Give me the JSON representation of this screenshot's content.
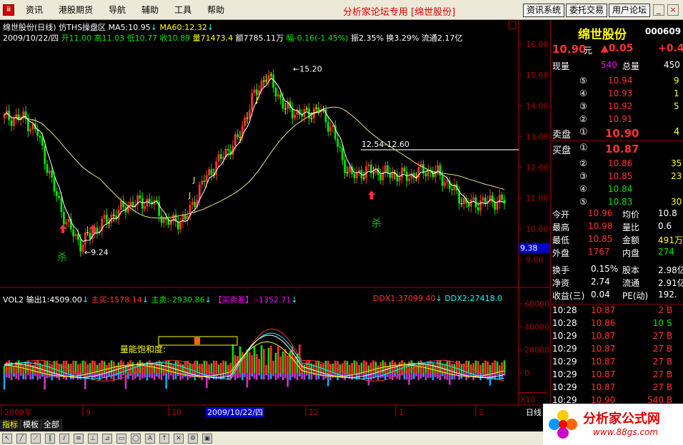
{
  "menu": {
    "items": [
      "资讯",
      "港股期货",
      "导航",
      "辅助",
      "工具",
      "帮助"
    ],
    "title": "分析家论坛专用 [绵世股份]",
    "buttons": [
      "资讯系统",
      "委托交易",
      "用户论坛"
    ],
    "window_controls": [
      "_",
      "▫",
      "×"
    ]
  },
  "info": {
    "line1": {
      "name": "绵世股份(日线)",
      "mode": "仿THS操盘区",
      "ma5": "MA5:10.95",
      "ma60": "MA60:12.32"
    },
    "line2": {
      "date": "2009/10/22/四",
      "open": "开11.00",
      "high": "高11.03",
      "low": "低10.77",
      "close": "收10.89",
      "volume": "量71473.4",
      "amount": "额7785.11万",
      "change": "幅-0.16(-1.45%)",
      "amplitude": "振2.35%",
      "turnover": "换3.29%",
      "float": "流通2.17亿"
    }
  },
  "price_axis": [
    "16.00",
    "15.00",
    "14.00",
    "13.00",
    "12.00",
    "11.00",
    "10.00",
    "9.00"
  ],
  "price_marker": "9.38",
  "annotations": {
    "high": "15.20",
    "low": "9.24",
    "range": "12.54-12.60",
    "kill1": "杀",
    "kill2": "杀",
    "j1": "J",
    "j2": "J",
    "j3": "J"
  },
  "indicator": {
    "name": "VOL2",
    "out1": "输出1:4509.00",
    "buy": "主买:1578.14",
    "sell": "主卖:-2930.86",
    "diff": "【买卖差】:-1352.71",
    "ddx1": "DDX1:37099.40",
    "ddx2": "DDX2:27418.0",
    "saturation_label": "量能饱和度:",
    "axis": [
      "60000",
      "40000",
      "20000",
      "0"
    ],
    "scale": "X10"
  },
  "time_axis": {
    "labels": [
      "2009年",
      "9",
      "10",
      "2009/10/22/四",
      "12",
      "1",
      "2"
    ],
    "period": "日线"
  },
  "quote": {
    "name": "绵世股份",
    "code": "000609",
    "price": "10.90",
    "unit": "元",
    "change": "▲0.05",
    "change_pct": "+0.4",
    "current_vol_label": "现量",
    "current_vol": "540",
    "total_vol_label": "总量",
    "total_vol": "450",
    "sells": [
      {
        "lvl": "⑤",
        "price": "10.94",
        "vol": "9"
      },
      {
        "lvl": "④",
        "price": "10.93",
        "vol": "1"
      },
      {
        "lvl": "③",
        "price": "10.92",
        "vol": "5"
      },
      {
        "lvl": "②",
        "price": "10.91",
        "vol": ""
      }
    ],
    "sell1": {
      "label": "卖盘",
      "lvl": "①",
      "price": "10.90",
      "vol": "4"
    },
    "buy1": {
      "label": "买盘",
      "lvl": "①",
      "price": "10.87",
      "vol": ""
    },
    "buys": [
      {
        "lvl": "②",
        "price": "10.86",
        "vol": "35"
      },
      {
        "lvl": "③",
        "price": "10.85",
        "vol": "23"
      },
      {
        "lvl": "④",
        "price": "10.84",
        "vol": ""
      },
      {
        "lvl": "⑤",
        "price": "10.83",
        "vol": "30"
      }
    ],
    "stats": [
      {
        "l1": "今开",
        "v1": "10.96",
        "l2": "均价",
        "v2": "10.8"
      },
      {
        "l1": "最高",
        "v1": "10.98",
        "l2": "量比",
        "v2": "0.6"
      },
      {
        "l1": "最低",
        "v1": "10.85",
        "l2": "金额",
        "v2": "491万"
      },
      {
        "l1": "外盘",
        "v1": "1767",
        "l2": "内盘",
        "v2": "274"
      }
    ],
    "stats2": [
      {
        "l1": "换手",
        "v1": "0.15%",
        "l2": "股本",
        "v2": "2.98亿"
      },
      {
        "l1": "净资",
        "v1": "2.74",
        "l2": "流通",
        "v2": "2.91亿"
      },
      {
        "l1": "收益(三)",
        "v1": "0.04",
        "l2": "PE(动)",
        "v2": "192."
      }
    ],
    "ticks": [
      {
        "t": "10:28",
        "p": "10.87",
        "v": "2",
        "s": "B"
      },
      {
        "t": "10:28",
        "p": "10.86",
        "v": "10",
        "s": "S"
      },
      {
        "t": "10:29",
        "p": "10.87",
        "v": "27",
        "s": "B"
      },
      {
        "t": "10:29",
        "p": "10.87",
        "v": "27",
        "s": "B"
      },
      {
        "t": "10:29",
        "p": "10.87",
        "v": "27",
        "s": "B"
      },
      {
        "t": "10:29",
        "p": "10.87",
        "v": "27",
        "s": "B"
      },
      {
        "t": "10:29",
        "p": "10.87",
        "v": "27",
        "s": "B"
      },
      {
        "t": "10:29",
        "p": "10.90",
        "v": "540",
        "s": "B"
      }
    ]
  },
  "bottom_tabs": [
    "指标",
    "模板",
    "全部"
  ],
  "logo": {
    "title": "分析家公式网",
    "url": "www.88gs.com"
  },
  "colors": {
    "up": "#ff3232",
    "down": "#00e600",
    "flat": "#ffff00",
    "ma60": "#e6e680",
    "ma5": "#ffffff",
    "ddx1": "#ff3232",
    "ddx2": "#00ffff"
  }
}
